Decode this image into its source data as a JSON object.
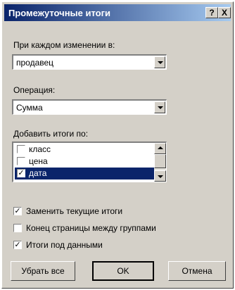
{
  "dialog": {
    "title": "Промежуточные итоги",
    "help_button": "?",
    "close_button": "X"
  },
  "group_by": {
    "label": "При каждом изменении в:",
    "value": "продавец"
  },
  "operation": {
    "label": "Операция:",
    "value": "Сумма"
  },
  "add_totals": {
    "label": "Добавить итоги по:",
    "items": [
      {
        "label": "класс",
        "checked": false,
        "selected": false
      },
      {
        "label": "цена",
        "checked": false,
        "selected": false
      },
      {
        "label": "дата",
        "checked": true,
        "selected": true
      }
    ]
  },
  "options": {
    "replace_current": {
      "label": "Заменить текущие итоги",
      "checked": true
    },
    "page_break": {
      "label": "Конец страницы между группами",
      "checked": false
    },
    "summary_below": {
      "label": "Итоги под данными",
      "checked": true
    }
  },
  "buttons": {
    "remove_all": "Убрать все",
    "ok": "OK",
    "cancel": "Отмена"
  },
  "colors": {
    "titlebar_start": "#0a246a",
    "titlebar_end": "#a6caf0",
    "selection": "#0a246a",
    "face": "#d4d0c8"
  }
}
